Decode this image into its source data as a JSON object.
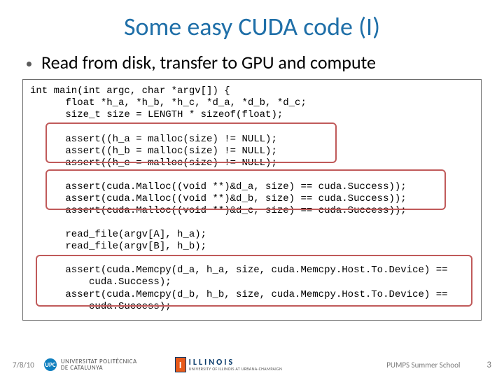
{
  "title": "Some easy CUDA code (I)",
  "bullet": "Read from disk, transfer to GPU and compute",
  "code": "int main(int argc, char *argv[]) {\n      float *h_a, *h_b, *h_c, *d_a, *d_b, *d_c;\n      size_t size = LENGTH * sizeof(float);\n\n      assert((h_a = malloc(size) != NULL);\n      assert((h_b = malloc(size) != NULL);\n      assert((h_c = malloc(size) != NULL);\n\n      assert(cuda.Malloc((void **)&d_a, size) == cuda.Success));\n      assert(cuda.Malloc((void **)&d_b, size) == cuda.Success));\n      assert(cuda.Malloc((void **)&d_c, size) == cuda.Success));\n\n      read_file(argv[A], h_a);\n      read_file(argv[B], h_b);\n\n      assert(cuda.Memcpy(d_a, h_a, size, cuda.Memcpy.Host.To.Device) ==\n          cuda.Success);\n      assert(cuda.Memcpy(d_b, h_b, size, cuda.Memcpy.Host.To.Device) ==\n          cuda.Success);",
  "footer": {
    "date": "7/8/10",
    "upc_badge": "UPC",
    "upc_text1": "UNIVERSITAT POLITÈCNICA",
    "upc_text2": "DE CATALUNYA",
    "ill_letter": "I",
    "ill_main": "ILLINOIS",
    "ill_sub": "UNIVERSITY OF ILLINOIS AT URBANA-CHAMPAIGN",
    "school": "PUMPS Summer School",
    "page": "3"
  }
}
